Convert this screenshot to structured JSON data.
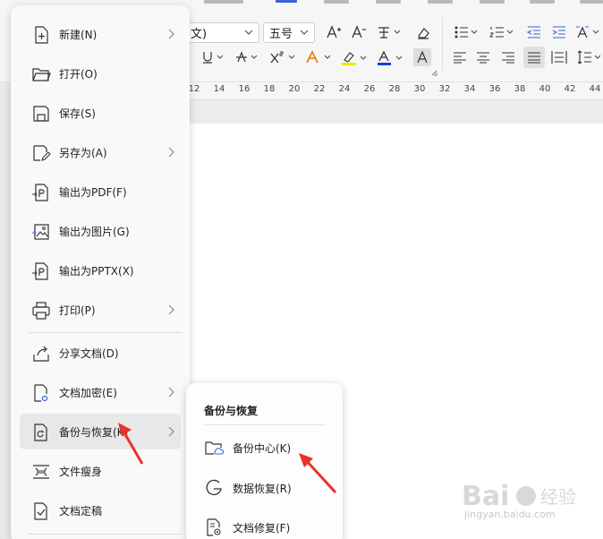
{
  "ribbon": {
    "font_name": "文)",
    "font_size": "五号"
  },
  "ruler": {
    "ticks": [
      "12",
      "14",
      "16",
      "18",
      "20",
      "22",
      "24",
      "26",
      "28",
      "30",
      "32",
      "34",
      "36",
      "38",
      "40",
      "42",
      "44"
    ]
  },
  "file_menu": {
    "items": [
      {
        "label": "新建(N)",
        "icon": "new-file-icon",
        "has_submenu": true
      },
      {
        "label": "打开(O)",
        "icon": "folder-open-icon",
        "has_submenu": false
      },
      {
        "label": "保存(S)",
        "icon": "save-icon",
        "has_submenu": false
      },
      {
        "label": "另存为(A)",
        "icon": "save-as-icon",
        "has_submenu": true
      },
      {
        "label": "输出为PDF(F)",
        "icon": "export-pdf-icon",
        "has_submenu": false
      },
      {
        "label": "输出为图片(G)",
        "icon": "export-image-icon",
        "has_submenu": false
      },
      {
        "label": "输出为PPTX(X)",
        "icon": "export-pptx-icon",
        "has_submenu": false
      },
      {
        "label": "打印(P)",
        "icon": "print-icon",
        "has_submenu": true
      },
      {
        "label": "分享文档(D)",
        "icon": "share-icon",
        "has_submenu": false
      },
      {
        "label": "文档加密(E)",
        "icon": "encrypt-icon",
        "has_submenu": true
      },
      {
        "label": "备份与恢复(K)",
        "icon": "backup-icon",
        "has_submenu": true
      },
      {
        "label": "文件瘦身",
        "icon": "slim-icon",
        "has_submenu": false
      },
      {
        "label": "文档定稿",
        "icon": "finalize-icon",
        "has_submenu": false
      }
    ]
  },
  "backup_submenu": {
    "title": "备份与恢复",
    "items": [
      {
        "label": "备份中心(K)",
        "icon": "backup-center-icon"
      },
      {
        "label": "数据恢复(R)",
        "icon": "data-recovery-icon"
      },
      {
        "label": "文档修复(F)",
        "icon": "doc-repair-icon"
      }
    ]
  },
  "colors": {
    "accent": "#3a64d8",
    "arrow": "#e8322d",
    "highlight": "#f5e400",
    "font_color": "#1e3fd0"
  },
  "watermark": {
    "text": "jingyan.baidu.com"
  }
}
